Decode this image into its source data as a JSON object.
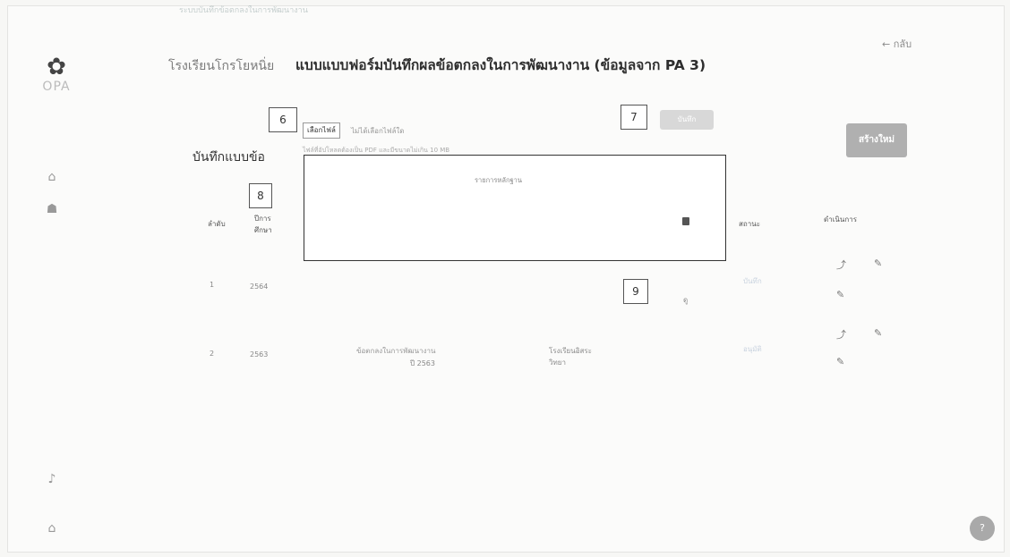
{
  "header": {
    "top_faint_text": "ระบบบันทึกข้อตกลงในการพัฒนางาน",
    "back_label": "← กลับ",
    "school_name": "โรงเรียนโกรโยหนิ่ย",
    "page_title": "แบบแบบฟอร์มบันทึกผลข้อตกลงในการพัฒนางาน (ข้อมูลจาก PA 3)"
  },
  "sidebar": {
    "logo_mark": "✿",
    "logo_text": "OPA",
    "icons": [
      "home-icon",
      "users-icon",
      "bell-icon",
      "settings-icon"
    ]
  },
  "upload": {
    "section_title": "บันทึกแบบข้อ",
    "choose_file_label": "เลือกไฟล์",
    "no_file_text": "ไม่ได้เลือกไฟล์ใด",
    "hint": "ไฟล์ที่อัปโหลดต้องเป็น PDF และมีขนาดไม่เกิน 10 MB",
    "save_button": "บันทึก",
    "create_button": "สร้างใหม่"
  },
  "popup": {
    "title": "รายการหลักฐาน"
  },
  "callouts": {
    "c6": "6",
    "c7": "7",
    "c8": "8",
    "c9": "9"
  },
  "table": {
    "headers": {
      "order": "ลำดับ",
      "year": "ปีการ ศึกษา",
      "status": "สถานะ",
      "actions": "ดำเนินการ"
    },
    "rows": [
      {
        "order": "1",
        "year": "2564",
        "link_text": "ดู",
        "status": "บันทึก"
      },
      {
        "order": "2",
        "year": "2563",
        "title": "ข้อตกลงในการพัฒนางาน",
        "subtitle": "ปี 2563",
        "school": "โรงเรียนอิสระ",
        "school_sub": "วิทยา",
        "status": "อนุมัติ"
      }
    ]
  },
  "chat_label": "?"
}
